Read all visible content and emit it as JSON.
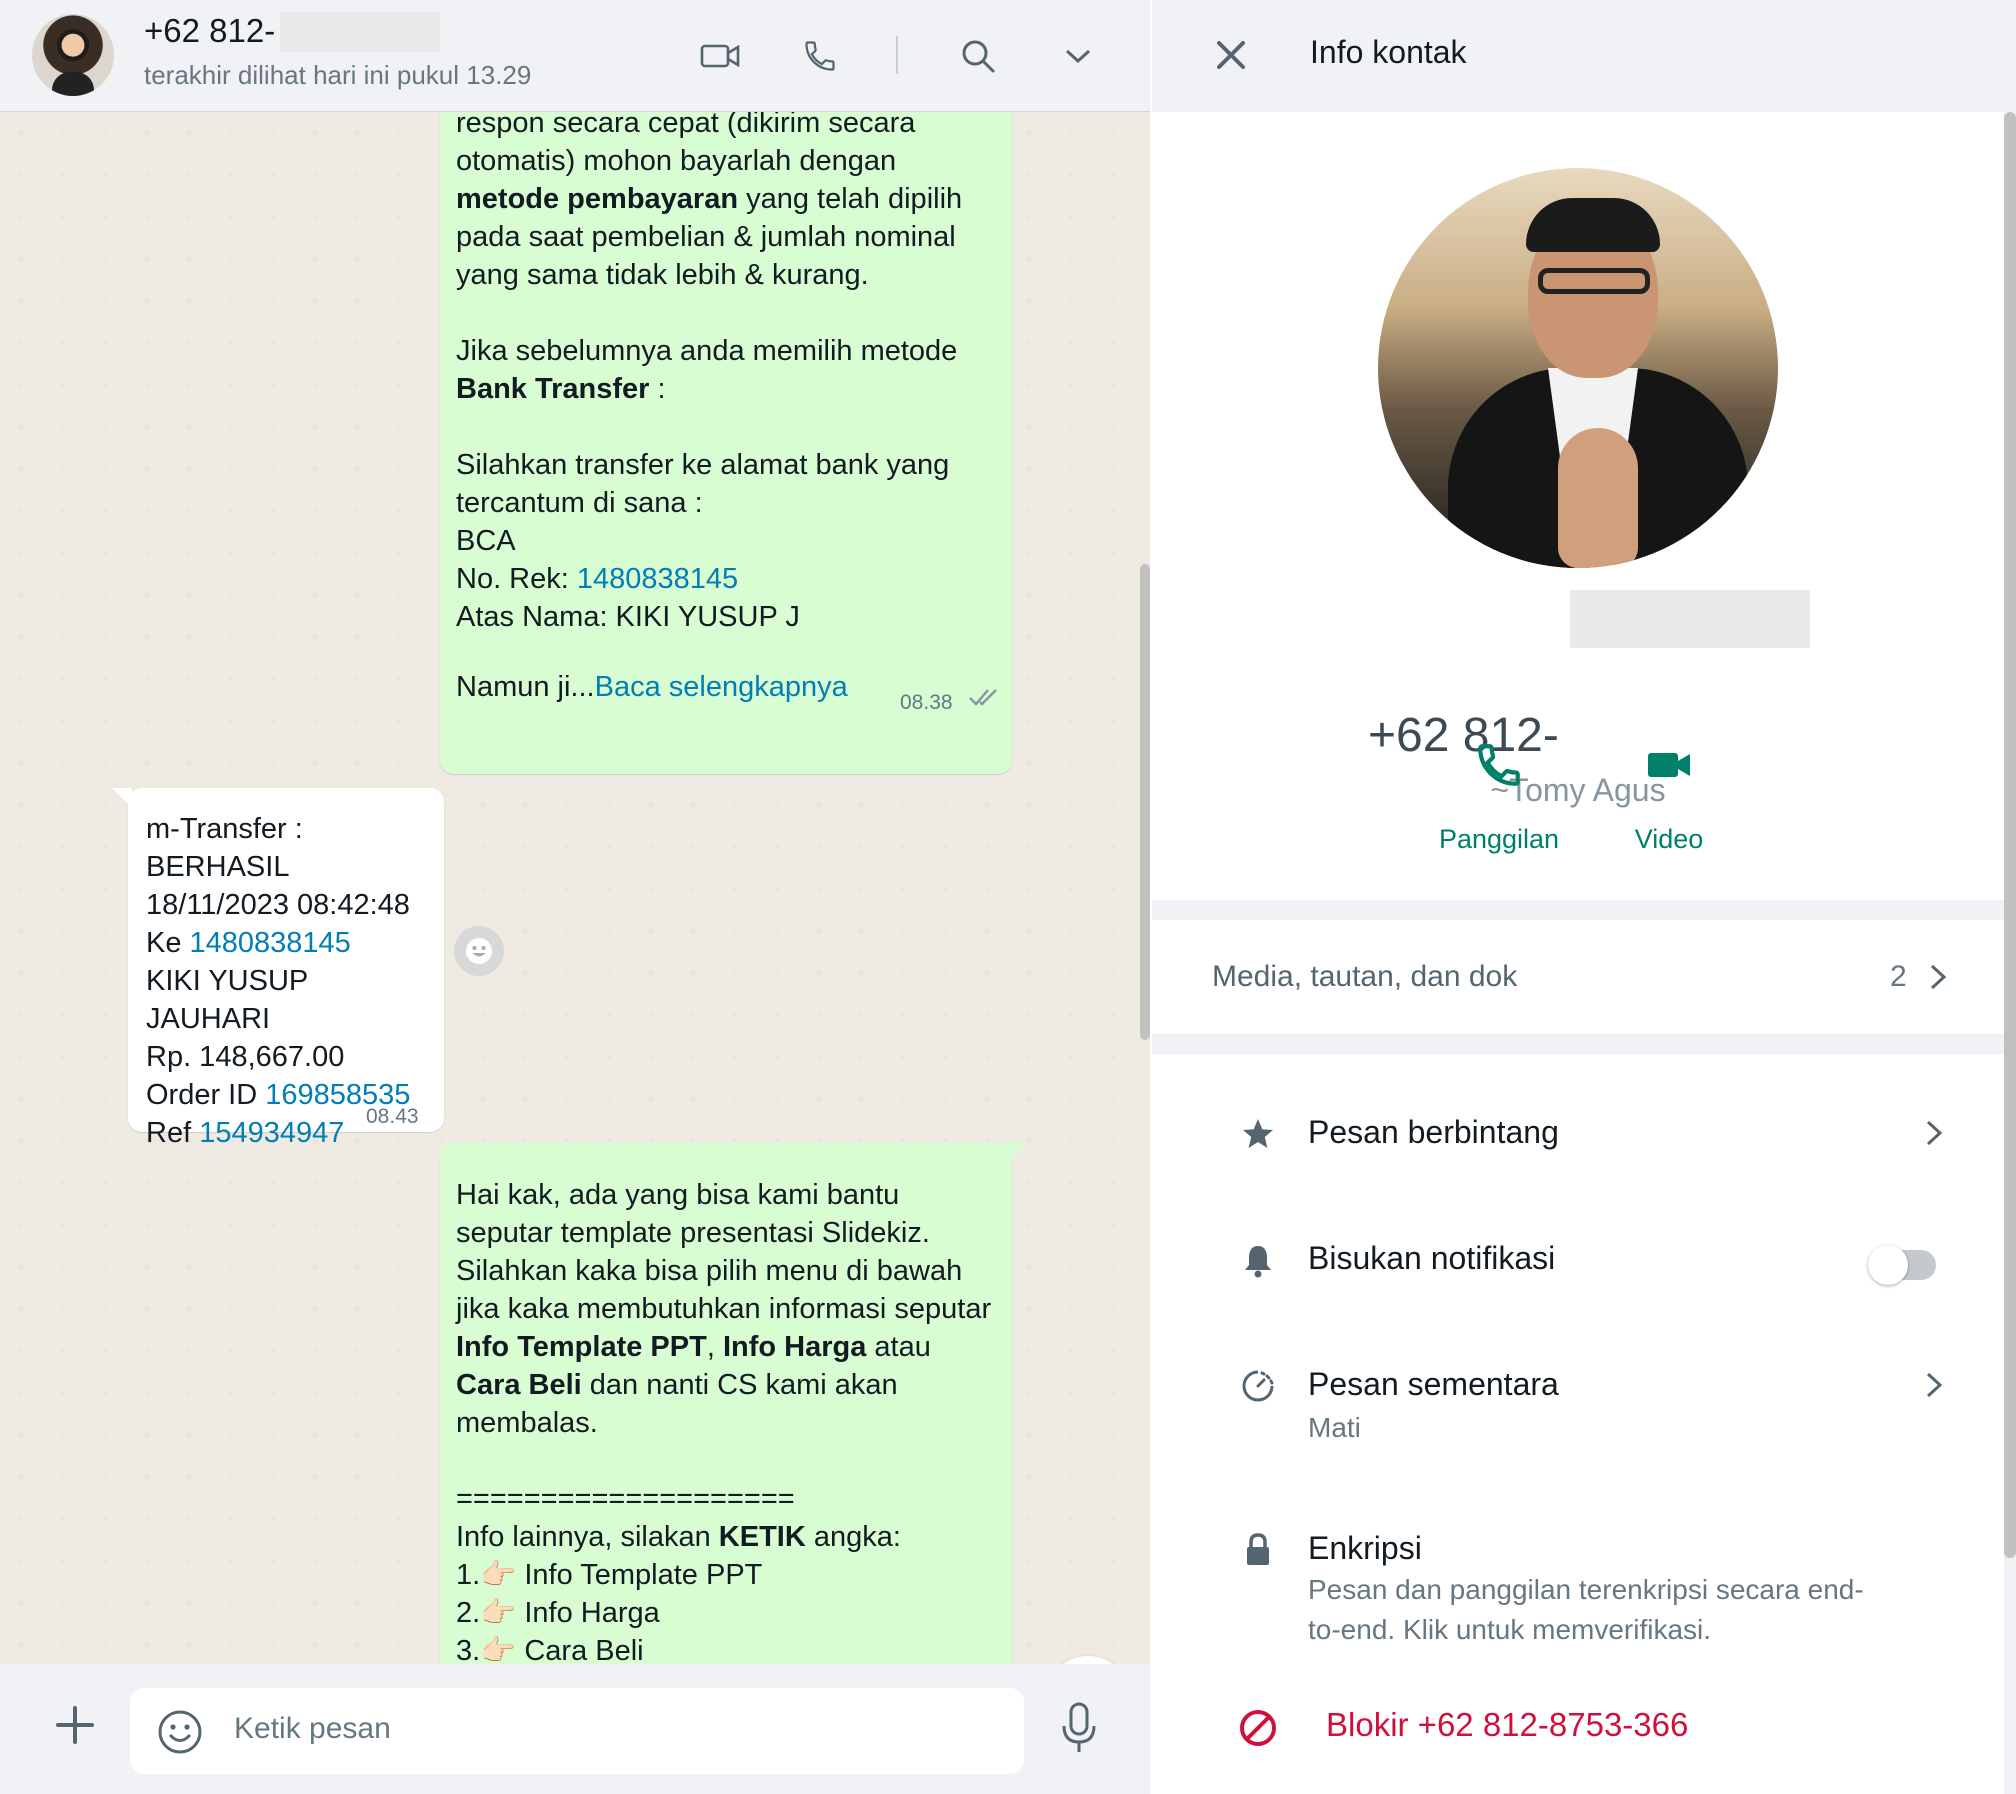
{
  "chat": {
    "header": {
      "name": "+62 812-",
      "last_seen": "terakhir dilihat hari ini pukul 13.29"
    },
    "messages": {
      "m1": {
        "lines": [
          {
            "t": "respon secara cepat (dikirim secara"
          },
          {
            "t": "otomatis) mohon bayarlah dengan"
          },
          {
            "b": "metode pembayaran",
            "t": " yang telah dipilih"
          },
          {
            "t": "pada saat pembelian & jumlah nominal"
          },
          {
            "t": "yang sama tidak lebih & kurang."
          },
          {
            "t": ""
          },
          {
            "t": "Jika sebelumnya anda memilih metode"
          },
          {
            "b": "Bank Transfer",
            "t": " :"
          },
          {
            "t": ""
          },
          {
            "t": "Silahkan transfer ke alamat bank yang"
          },
          {
            "t": "tercantum di sana :"
          },
          {
            "t": "BCA"
          },
          {
            "t": "No. Rek: ",
            "link": "1480838145"
          },
          {
            "t": "Atas Nama: KIKI YUSUP J"
          }
        ],
        "truncated_prefix": "Namun ji...",
        "read_more": "Baca selengkapnya",
        "time": "08.38"
      },
      "m2": {
        "lines": [
          {
            "t": "m-Transfer :"
          },
          {
            "t": "BERHASIL"
          },
          {
            "t": "18/11/2023 08:42:48"
          },
          {
            "t": "Ke ",
            "link": "1480838145"
          },
          {
            "t": "KIKI YUSUP JAUHARI"
          },
          {
            "t": "Rp. 148,667.00"
          },
          {
            "t": "Order ID ",
            "link": "169858535"
          },
          {
            "t": "Ref ",
            "link": "154934947"
          }
        ],
        "time": "08.43"
      },
      "m3": {
        "lines": [
          {
            "t": "Hai kak, ada yang bisa kami bantu"
          },
          {
            "t": "seputar template presentasi Slidekiz."
          },
          {
            "t": "Silahkan kaka bisa pilih menu di bawah"
          },
          {
            "t": "jika kaka membutuhkan informasi seputar"
          },
          {
            "b": "Info Template PPT",
            "t": ", ",
            "b2": "Info Harga",
            "t2": " atau"
          },
          {
            "b": "Cara Beli",
            "t": " dan nanti CS kami akan"
          },
          {
            "t": "membalas."
          },
          {
            "t": ""
          },
          {
            "t": "===================="
          },
          {
            "t": "Info lainnya, silakan ",
            "b": "KETIK",
            "t2": " angka:"
          },
          {
            "t": "1.👉🏻 Info Template PPT"
          },
          {
            "t": "2.👉🏻 Info Harga"
          },
          {
            "t": "3.👉🏻 Cara Beli"
          }
        ]
      }
    },
    "composer": {
      "placeholder": "Ketik pesan"
    }
  },
  "info": {
    "title": "Info kontak",
    "phone": "+62 812-",
    "pushname": "~Tomy Agus",
    "actions": {
      "call": "Panggilan",
      "video": "Video"
    },
    "media": {
      "label": "Media, tautan, dan dok",
      "count": "2"
    },
    "starred": "Pesan berbintang",
    "mute": "Bisukan notifikasi",
    "disappearing": {
      "title": "Pesan sementara",
      "status": "Mati"
    },
    "encryption": {
      "title": "Enkripsi",
      "line1": "Pesan dan panggilan terenkripsi secara end-",
      "line2": "to-end. Klik untuk memverifikasi."
    },
    "block": "Blokir +62 812-8753-366"
  },
  "colors": {
    "outgoing_bubble": "#d9fdd3",
    "accent_green": "#008069",
    "link_blue": "#027eb5",
    "danger_red": "#d0103a"
  },
  "icons": [
    "video-call-icon",
    "voice-call-icon",
    "search-icon",
    "chevron-down-icon",
    "close-icon",
    "star-icon",
    "bell-icon",
    "timer-icon",
    "lock-icon",
    "block-icon",
    "plus-icon",
    "emoji-icon",
    "mic-icon",
    "double-check-icon"
  ]
}
